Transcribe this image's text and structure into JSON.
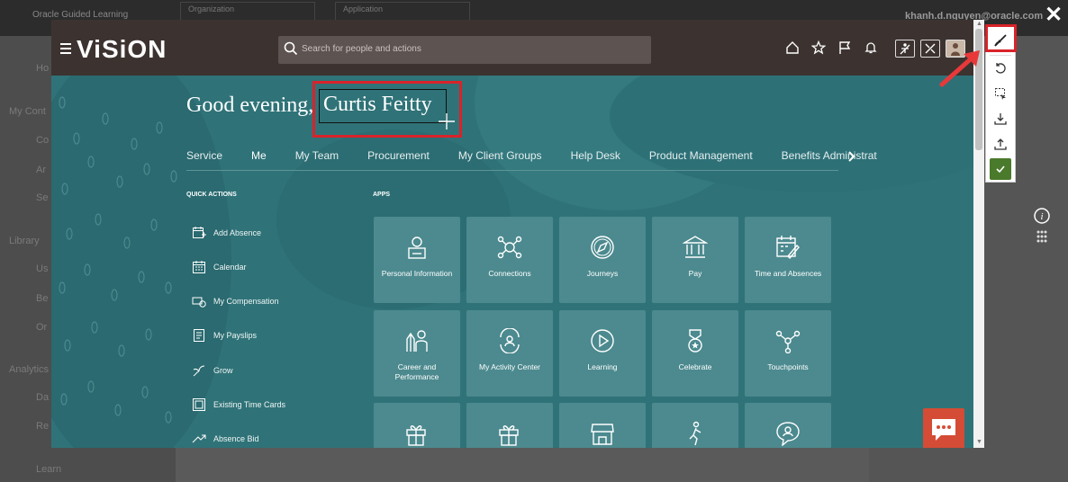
{
  "background": {
    "brand": "Oracle Guided Learning",
    "dropdown1": "Organization",
    "dropdown2": "Application",
    "user": "khanh.d.nguyen@oracle.com",
    "sidebar": [
      "Ho",
      "My Cont",
      "Co",
      "Ar",
      "Se",
      "Library",
      "Us",
      "Be",
      "Or",
      "Analytics",
      "Da",
      "Re",
      "Learn"
    ]
  },
  "header": {
    "logo": "ViSiON",
    "search_placeholder": "Search for people and actions"
  },
  "greeting": {
    "prefix": "Good evening,",
    "name": "Curtis Feitty"
  },
  "tabs": [
    "Service",
    "Me",
    "My Team",
    "Procurement",
    "My Client Groups",
    "Help Desk",
    "Product Management",
    "Benefits Administration"
  ],
  "active_tab": "Me",
  "quick_actions": {
    "title": "QUICK ACTIONS",
    "items": [
      "Add Absence",
      "Calendar",
      "My Compensation",
      "My Payslips",
      "Grow",
      "Existing Time Cards",
      "Absence Bid"
    ]
  },
  "apps": {
    "title": "APPS",
    "tiles": [
      {
        "label": "Personal Information",
        "icon": "person-info-icon"
      },
      {
        "label": "Connections",
        "icon": "connections-icon"
      },
      {
        "label": "Journeys",
        "icon": "compass-icon"
      },
      {
        "label": "Pay",
        "icon": "bank-icon"
      },
      {
        "label": "Time and Absences",
        "icon": "calendar-edit-icon"
      },
      {
        "label": "Career and Performance",
        "icon": "career-icon"
      },
      {
        "label": "My Activity Center",
        "icon": "activity-icon"
      },
      {
        "label": "Learning",
        "icon": "play-icon"
      },
      {
        "label": "Celebrate",
        "icon": "medal-icon"
      },
      {
        "label": "Touchpoints",
        "icon": "touchpoints-icon"
      },
      {
        "label": "",
        "icon": "gift-icon"
      },
      {
        "label": "",
        "icon": "gift-icon"
      },
      {
        "label": "",
        "icon": "store-icon"
      },
      {
        "label": "",
        "icon": "wellness-icon"
      },
      {
        "label": "",
        "icon": "chat-person-icon"
      }
    ]
  },
  "colors": {
    "header": "#3c3330",
    "content": "#2f7378",
    "tile": "#4c8a8f",
    "highlight": "#d9232a",
    "chat": "#d44c35"
  }
}
